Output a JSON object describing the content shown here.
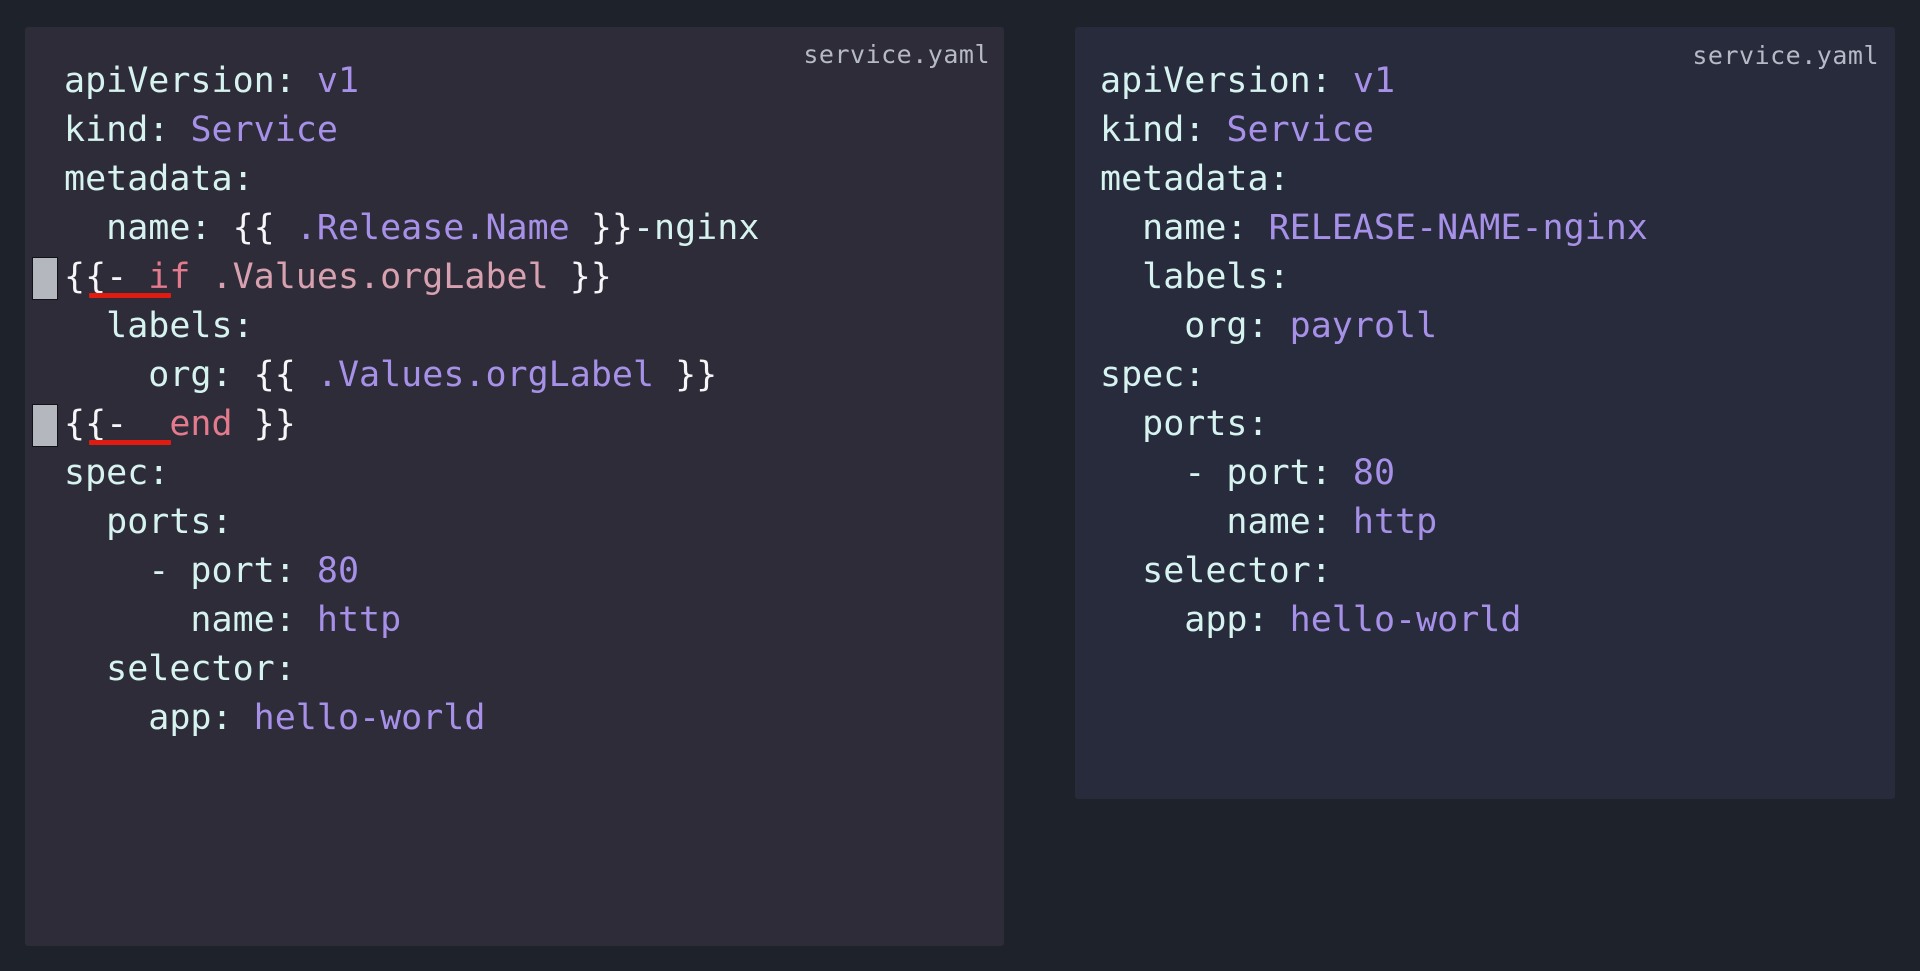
{
  "theme": {
    "page_background": "#1d222b",
    "template_panel_background": "#2e2c38",
    "rendered_panel_background": "#282b3c",
    "text_key_color": "#d6f3f0",
    "text_value_color": "#a791e8",
    "brace_color": "#f6f6f8",
    "keyword_color": "#e47a8e",
    "expr_var_color": "#d8a1b0",
    "file_label_color": "#b6bac6",
    "marker_block_color": "#b5b7bf",
    "underline_color": "#e01b12"
  },
  "panels": [
    {
      "id": "template-panel",
      "file_label": "service.yaml",
      "lines": [
        {
          "id": "line-apiversion",
          "marker": false,
          "underline": false,
          "tokens": [
            {
              "text": "apiVersion: ",
              "style": "k"
            },
            {
              "text": "v1",
              "style": "val"
            }
          ]
        },
        {
          "id": "line-kind",
          "marker": false,
          "underline": false,
          "tokens": [
            {
              "text": "kind: ",
              "style": "k"
            },
            {
              "text": "Service",
              "style": "val"
            }
          ]
        },
        {
          "id": "line-metadata",
          "marker": false,
          "underline": false,
          "tokens": [
            {
              "text": "metadata:",
              "style": "k"
            }
          ]
        },
        {
          "id": "line-name",
          "marker": false,
          "underline": false,
          "tokens": [
            {
              "text": "  name: ",
              "style": "k"
            },
            {
              "text": "{{",
              "style": "br"
            },
            {
              "text": " .Release.Name ",
              "style": "pvar"
            },
            {
              "text": "}}",
              "style": "br"
            },
            {
              "text": "-nginx",
              "style": "k"
            }
          ]
        },
        {
          "id": "line-if-orglabel",
          "marker": true,
          "underline": true,
          "tokens": [
            {
              "text": "{{-",
              "style": "br"
            },
            {
              "text": " if",
              "style": "kw"
            },
            {
              "text": " .Values.orgLabel ",
              "style": "var"
            },
            {
              "text": "}}",
              "style": "br"
            }
          ]
        },
        {
          "id": "line-labels",
          "marker": false,
          "underline": false,
          "tokens": [
            {
              "text": "  labels:",
              "style": "k"
            }
          ]
        },
        {
          "id": "line-org",
          "marker": false,
          "underline": false,
          "tokens": [
            {
              "text": "    org: ",
              "style": "k"
            },
            {
              "text": "{{",
              "style": "br"
            },
            {
              "text": " .Values.orgLabel ",
              "style": "pvar"
            },
            {
              "text": "}}",
              "style": "br"
            }
          ]
        },
        {
          "id": "line-end",
          "marker": true,
          "underline": true,
          "tokens": [
            {
              "text": "{{-",
              "style": "br"
            },
            {
              "text": "  end",
              "style": "kw"
            },
            {
              "text": " ",
              "style": "k"
            },
            {
              "text": "}}",
              "style": "br"
            }
          ]
        },
        {
          "id": "line-spec",
          "marker": false,
          "underline": false,
          "tokens": [
            {
              "text": "spec:",
              "style": "k"
            }
          ]
        },
        {
          "id": "line-ports",
          "marker": false,
          "underline": false,
          "tokens": [
            {
              "text": "  ports:",
              "style": "k"
            }
          ]
        },
        {
          "id": "line-port",
          "marker": false,
          "underline": false,
          "tokens": [
            {
              "text": "    - port: ",
              "style": "k"
            },
            {
              "text": "80",
              "style": "val"
            }
          ]
        },
        {
          "id": "line-portname",
          "marker": false,
          "underline": false,
          "tokens": [
            {
              "text": "      name: ",
              "style": "k"
            },
            {
              "text": "http",
              "style": "val"
            }
          ]
        },
        {
          "id": "line-selector",
          "marker": false,
          "underline": false,
          "tokens": [
            {
              "text": "  selector:",
              "style": "k"
            }
          ]
        },
        {
          "id": "line-app",
          "marker": false,
          "underline": false,
          "tokens": [
            {
              "text": "    app: ",
              "style": "k"
            },
            {
              "text": "hello-world",
              "style": "val"
            }
          ]
        }
      ]
    },
    {
      "id": "rendered-panel",
      "file_label": "service.yaml",
      "lines": [
        {
          "id": "r-line-apiversion",
          "marker": false,
          "underline": false,
          "tokens": [
            {
              "text": "apiVersion: ",
              "style": "k"
            },
            {
              "text": "v1",
              "style": "val"
            }
          ]
        },
        {
          "id": "r-line-kind",
          "marker": false,
          "underline": false,
          "tokens": [
            {
              "text": "kind: ",
              "style": "k"
            },
            {
              "text": "Service",
              "style": "val"
            }
          ]
        },
        {
          "id": "r-line-metadata",
          "marker": false,
          "underline": false,
          "tokens": [
            {
              "text": "metadata:",
              "style": "k"
            }
          ]
        },
        {
          "id": "r-line-name",
          "marker": false,
          "underline": false,
          "tokens": [
            {
              "text": "  name: ",
              "style": "k"
            },
            {
              "text": "RELEASE-NAME-nginx",
              "style": "val"
            }
          ]
        },
        {
          "id": "r-line-labels",
          "marker": false,
          "underline": false,
          "tokens": [
            {
              "text": "  labels:",
              "style": "k"
            }
          ]
        },
        {
          "id": "r-line-org",
          "marker": false,
          "underline": false,
          "tokens": [
            {
              "text": "    org: ",
              "style": "k"
            },
            {
              "text": "payroll",
              "style": "val"
            }
          ]
        },
        {
          "id": "r-line-spec",
          "marker": false,
          "underline": false,
          "tokens": [
            {
              "text": "spec:",
              "style": "k"
            }
          ]
        },
        {
          "id": "r-line-ports",
          "marker": false,
          "underline": false,
          "tokens": [
            {
              "text": "  ports:",
              "style": "k"
            }
          ]
        },
        {
          "id": "r-line-port",
          "marker": false,
          "underline": false,
          "tokens": [
            {
              "text": "    - port: ",
              "style": "k"
            },
            {
              "text": "80",
              "style": "val"
            }
          ]
        },
        {
          "id": "r-line-portname",
          "marker": false,
          "underline": false,
          "tokens": [
            {
              "text": "      name: ",
              "style": "k"
            },
            {
              "text": "http",
              "style": "val"
            }
          ]
        },
        {
          "id": "r-line-selector",
          "marker": false,
          "underline": false,
          "tokens": [
            {
              "text": "  selector:",
              "style": "k"
            }
          ]
        },
        {
          "id": "r-line-app",
          "marker": false,
          "underline": false,
          "tokens": [
            {
              "text": "    app: ",
              "style": "k"
            },
            {
              "text": "hello-world",
              "style": "val"
            }
          ]
        }
      ]
    }
  ]
}
